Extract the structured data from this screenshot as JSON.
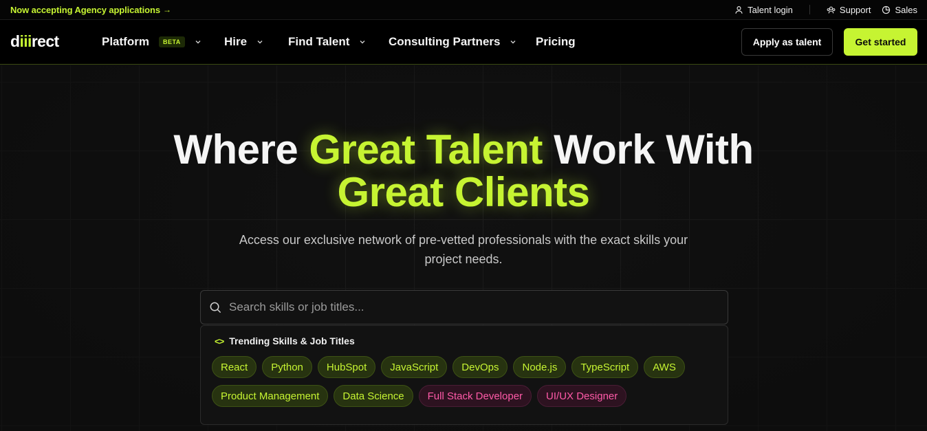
{
  "topbar": {
    "announcement": "Now accepting Agency applications",
    "arrow": "→",
    "links": [
      {
        "label": "Talent login",
        "icon": "user-icon"
      },
      {
        "label": "Support",
        "icon": "support-icon"
      },
      {
        "label": "Sales",
        "icon": "pie-chart-icon"
      }
    ]
  },
  "nav": {
    "logo": {
      "pre": "d",
      "accent": "iii",
      "post": "rect"
    },
    "items": [
      {
        "label": "Platform",
        "badge": "BETA"
      },
      {
        "label": "Hire"
      },
      {
        "label": "Find Talent"
      },
      {
        "label": "Consulting Partners"
      },
      {
        "label": "Pricing"
      }
    ],
    "apply_label": "Apply as talent",
    "cta_label": "Get started"
  },
  "hero": {
    "headline_1": "Where ",
    "headline_2": "Great Talent",
    "headline_3": " Work With",
    "headline_4": "Great Clients",
    "subtitle": "Access our exclusive network of pre-vetted professionals with the exact skills your project needs."
  },
  "search": {
    "placeholder": "Search skills or job titles..."
  },
  "trending": {
    "title": "Trending Skills & Job Titles",
    "icon": "code-icon",
    "chips": [
      {
        "label": "React",
        "tone": "green"
      },
      {
        "label": "Python",
        "tone": "green"
      },
      {
        "label": "HubSpot",
        "tone": "green"
      },
      {
        "label": "JavaScript",
        "tone": "green"
      },
      {
        "label": "DevOps",
        "tone": "green"
      },
      {
        "label": "Node.js",
        "tone": "green"
      },
      {
        "label": "TypeScript",
        "tone": "green"
      },
      {
        "label": "AWS",
        "tone": "green"
      },
      {
        "label": "Product Management",
        "tone": "green"
      },
      {
        "label": "Data Science",
        "tone": "green"
      },
      {
        "label": "Full Stack Developer",
        "tone": "pink"
      },
      {
        "label": "UI/UX Designer",
        "tone": "pink"
      }
    ]
  },
  "colors": {
    "accent": "#c6f432",
    "pink": "#ff5aa8",
    "background": "#111111"
  }
}
